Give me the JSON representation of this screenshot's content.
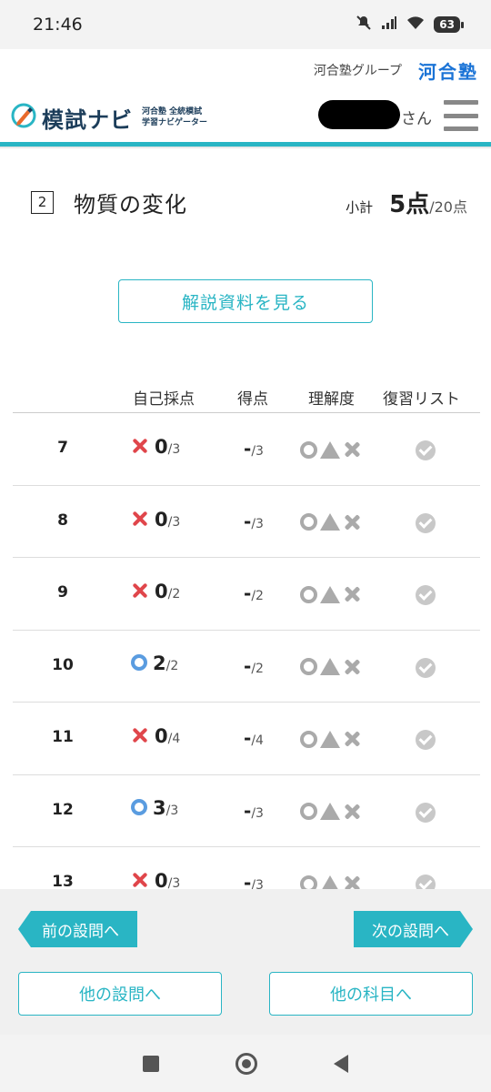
{
  "status": {
    "time": "21:46",
    "battery": "63"
  },
  "group": {
    "text": "河合塾グループ",
    "brand": "河合塾"
  },
  "header": {
    "logo_title": "模試ナビ",
    "logo_sub1": "河合塾 全統模試",
    "logo_sub2": "学習ナビゲーター",
    "user_suffix": "さん"
  },
  "section": {
    "number": "2",
    "title": "物質の変化",
    "subtotal_label": "小計",
    "score": "5点",
    "total": "/20点"
  },
  "explain_button": "解説資料を見る",
  "columns": {
    "self": "自己採点",
    "got": "得点",
    "understanding": "理解度",
    "review": "復習リスト"
  },
  "rows": [
    {
      "num": "7",
      "result": "x",
      "self": "0",
      "self_den": "/3",
      "got": "-",
      "got_den": "/3"
    },
    {
      "num": "8",
      "result": "x",
      "self": "0",
      "self_den": "/3",
      "got": "-",
      "got_den": "/3"
    },
    {
      "num": "9",
      "result": "x",
      "self": "0",
      "self_den": "/2",
      "got": "-",
      "got_den": "/2"
    },
    {
      "num": "10",
      "result": "o",
      "self": "2",
      "self_den": "/2",
      "got": "-",
      "got_den": "/2"
    },
    {
      "num": "11",
      "result": "x",
      "self": "0",
      "self_den": "/4",
      "got": "-",
      "got_den": "/4"
    },
    {
      "num": "12",
      "result": "o",
      "self": "3",
      "self_den": "/3",
      "got": "-",
      "got_den": "/3"
    },
    {
      "num": "13",
      "result": "x",
      "self": "0",
      "self_den": "/3",
      "got": "-",
      "got_den": "/3"
    }
  ],
  "footer": {
    "prev": "前の設問へ",
    "next": "次の設問へ",
    "other_question": "他の設問へ",
    "other_subject": "他の科目へ"
  },
  "colors": {
    "accent": "#29b5c4",
    "wrong": "#e0464b",
    "correct": "#5a9ce0",
    "brand": "#1a73d6"
  }
}
